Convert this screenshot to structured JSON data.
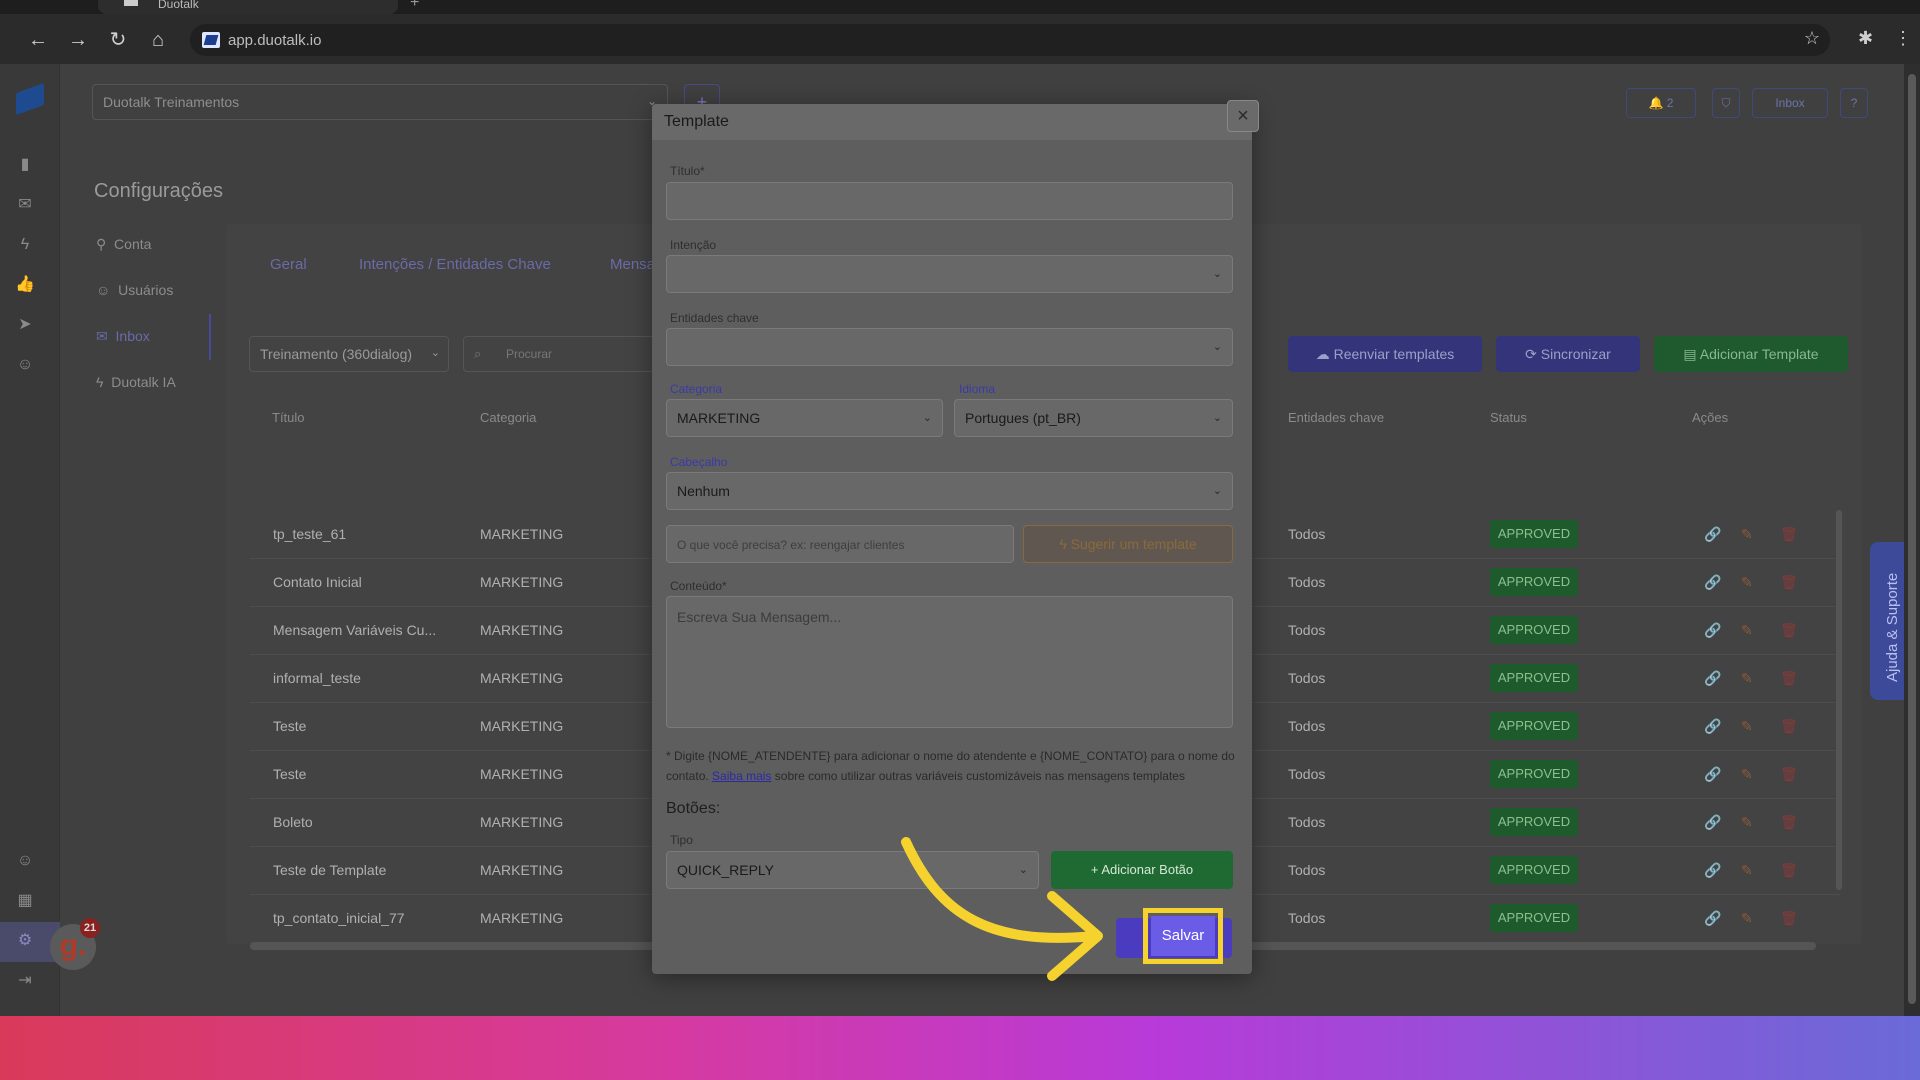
{
  "browser": {
    "tab_title": "Duotalk",
    "url": "app.duotalk.io"
  },
  "app": {
    "workspace_select": "Duotalk Treinamentos",
    "plus": "+",
    "notifications_count": "2",
    "inbox_button": "Inbox",
    "help_button": "?",
    "page_title": "Configurações",
    "submenu": [
      "Conta",
      "Usuários",
      "Inbox",
      "Duotalk IA"
    ],
    "tabs": [
      "Geral",
      "Intenções / Entidades Chave",
      "Mensa"
    ],
    "filter_select": "Treinamento (360dialog)",
    "search_placeholder": "Procurar",
    "buttons": {
      "resend": "Reenviar templates",
      "sync": "Sincronizar",
      "add_template": "Adicionar Template"
    },
    "table": {
      "headers": [
        "Título",
        "Categoria",
        "Entidades chave",
        "Status",
        "Ações"
      ],
      "rows": [
        {
          "title": "tp_teste_61",
          "category": "MARKETING",
          "entities": "Todos",
          "status": "APPROVED"
        },
        {
          "title": "Contato Inicial",
          "category": "MARKETING",
          "entities": "Todos",
          "status": "APPROVED"
        },
        {
          "title": "Mensagem Variáveis Cu...",
          "category": "MARKETING",
          "entities": "Todos",
          "status": "APPROVED"
        },
        {
          "title": "informal_teste",
          "category": "MARKETING",
          "entities": "Todos",
          "status": "APPROVED"
        },
        {
          "title": "Teste",
          "category": "MARKETING",
          "entities": "Todos",
          "status": "APPROVED"
        },
        {
          "title": "Teste",
          "category": "MARKETING",
          "entities": "Todos",
          "status": "APPROVED"
        },
        {
          "title": "Boleto",
          "category": "MARKETING",
          "entities": "Todos",
          "status": "APPROVED"
        },
        {
          "title": "Teste de Template",
          "category": "MARKETING",
          "entities": "Todos",
          "status": "APPROVED"
        },
        {
          "title": "tp_contato_inicial_77",
          "category": "MARKETING",
          "entities": "Todos",
          "status": "APPROVED"
        }
      ]
    },
    "help_tab": "Ajuda & Suporte",
    "avatar_letter": "g.",
    "avatar_count": "21"
  },
  "modal": {
    "title": "Template",
    "close": "×",
    "fields": {
      "title_label": "Título*",
      "title_value": "",
      "intent_label": "Intenção",
      "entities_label": "Entidades chave",
      "category_label": "Categoria",
      "category_value": "MARKETING",
      "language_label": "Idioma",
      "language_value": "Portugues (pt_BR)",
      "header_label": "Cabeçalho",
      "header_value": "Nenhum",
      "ai_prompt_placeholder": "O que você precisa? ex: reengajar clientes",
      "suggest_button": "Sugerir um template",
      "content_label": "Conteúdo*",
      "content_placeholder": "Escreva Sua Mensagem..."
    },
    "hint": {
      "text_before": "* Digite {NOME_ATENDENTE} para adicionar o nome do atendente e {NOME_CONTATO} para o nome do contato.",
      "link": "Saiba mais",
      "text_after": "sobre como utilizar outras variáveis customizáveis nas mensagens templates"
    },
    "buttons_section": "Botões:",
    "type_label": "Tipo",
    "type_value": "QUICK_REPLY",
    "add_button": "Adicionar Botão",
    "save_button": "Salvar"
  },
  "colors": {
    "highlight": "#f5d22e",
    "save_accent": "#6b5ce8",
    "approved": "#1d5a2c"
  }
}
